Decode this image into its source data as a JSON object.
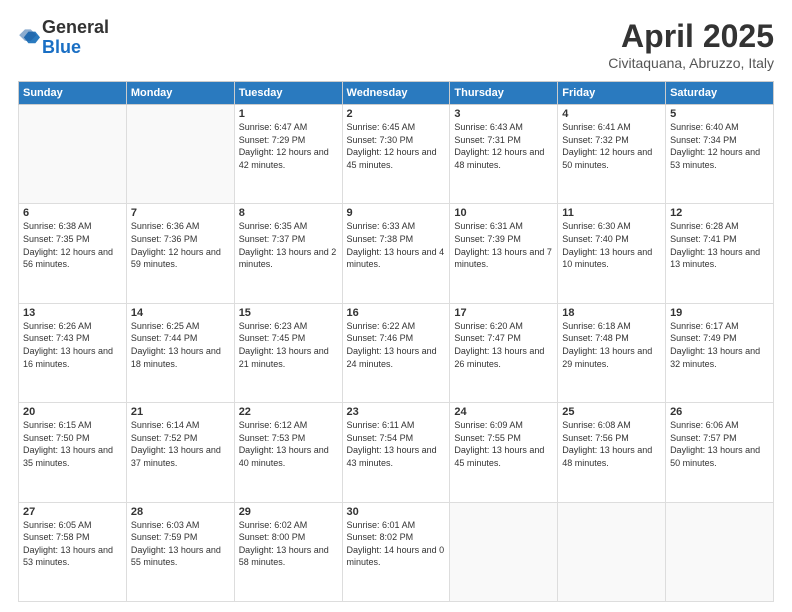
{
  "header": {
    "logo_general": "General",
    "logo_blue": "Blue",
    "title": "April 2025",
    "location": "Civitaquana, Abruzzo, Italy"
  },
  "weekdays": [
    "Sunday",
    "Monday",
    "Tuesday",
    "Wednesday",
    "Thursday",
    "Friday",
    "Saturday"
  ],
  "weeks": [
    [
      {
        "day": "",
        "sunrise": "",
        "sunset": "",
        "daylight": ""
      },
      {
        "day": "",
        "sunrise": "",
        "sunset": "",
        "daylight": ""
      },
      {
        "day": "1",
        "sunrise": "Sunrise: 6:47 AM",
        "sunset": "Sunset: 7:29 PM",
        "daylight": "Daylight: 12 hours and 42 minutes."
      },
      {
        "day": "2",
        "sunrise": "Sunrise: 6:45 AM",
        "sunset": "Sunset: 7:30 PM",
        "daylight": "Daylight: 12 hours and 45 minutes."
      },
      {
        "day": "3",
        "sunrise": "Sunrise: 6:43 AM",
        "sunset": "Sunset: 7:31 PM",
        "daylight": "Daylight: 12 hours and 48 minutes."
      },
      {
        "day": "4",
        "sunrise": "Sunrise: 6:41 AM",
        "sunset": "Sunset: 7:32 PM",
        "daylight": "Daylight: 12 hours and 50 minutes."
      },
      {
        "day": "5",
        "sunrise": "Sunrise: 6:40 AM",
        "sunset": "Sunset: 7:34 PM",
        "daylight": "Daylight: 12 hours and 53 minutes."
      }
    ],
    [
      {
        "day": "6",
        "sunrise": "Sunrise: 6:38 AM",
        "sunset": "Sunset: 7:35 PM",
        "daylight": "Daylight: 12 hours and 56 minutes."
      },
      {
        "day": "7",
        "sunrise": "Sunrise: 6:36 AM",
        "sunset": "Sunset: 7:36 PM",
        "daylight": "Daylight: 12 hours and 59 minutes."
      },
      {
        "day": "8",
        "sunrise": "Sunrise: 6:35 AM",
        "sunset": "Sunset: 7:37 PM",
        "daylight": "Daylight: 13 hours and 2 minutes."
      },
      {
        "day": "9",
        "sunrise": "Sunrise: 6:33 AM",
        "sunset": "Sunset: 7:38 PM",
        "daylight": "Daylight: 13 hours and 4 minutes."
      },
      {
        "day": "10",
        "sunrise": "Sunrise: 6:31 AM",
        "sunset": "Sunset: 7:39 PM",
        "daylight": "Daylight: 13 hours and 7 minutes."
      },
      {
        "day": "11",
        "sunrise": "Sunrise: 6:30 AM",
        "sunset": "Sunset: 7:40 PM",
        "daylight": "Daylight: 13 hours and 10 minutes."
      },
      {
        "day": "12",
        "sunrise": "Sunrise: 6:28 AM",
        "sunset": "Sunset: 7:41 PM",
        "daylight": "Daylight: 13 hours and 13 minutes."
      }
    ],
    [
      {
        "day": "13",
        "sunrise": "Sunrise: 6:26 AM",
        "sunset": "Sunset: 7:43 PM",
        "daylight": "Daylight: 13 hours and 16 minutes."
      },
      {
        "day": "14",
        "sunrise": "Sunrise: 6:25 AM",
        "sunset": "Sunset: 7:44 PM",
        "daylight": "Daylight: 13 hours and 18 minutes."
      },
      {
        "day": "15",
        "sunrise": "Sunrise: 6:23 AM",
        "sunset": "Sunset: 7:45 PM",
        "daylight": "Daylight: 13 hours and 21 minutes."
      },
      {
        "day": "16",
        "sunrise": "Sunrise: 6:22 AM",
        "sunset": "Sunset: 7:46 PM",
        "daylight": "Daylight: 13 hours and 24 minutes."
      },
      {
        "day": "17",
        "sunrise": "Sunrise: 6:20 AM",
        "sunset": "Sunset: 7:47 PM",
        "daylight": "Daylight: 13 hours and 26 minutes."
      },
      {
        "day": "18",
        "sunrise": "Sunrise: 6:18 AM",
        "sunset": "Sunset: 7:48 PM",
        "daylight": "Daylight: 13 hours and 29 minutes."
      },
      {
        "day": "19",
        "sunrise": "Sunrise: 6:17 AM",
        "sunset": "Sunset: 7:49 PM",
        "daylight": "Daylight: 13 hours and 32 minutes."
      }
    ],
    [
      {
        "day": "20",
        "sunrise": "Sunrise: 6:15 AM",
        "sunset": "Sunset: 7:50 PM",
        "daylight": "Daylight: 13 hours and 35 minutes."
      },
      {
        "day": "21",
        "sunrise": "Sunrise: 6:14 AM",
        "sunset": "Sunset: 7:52 PM",
        "daylight": "Daylight: 13 hours and 37 minutes."
      },
      {
        "day": "22",
        "sunrise": "Sunrise: 6:12 AM",
        "sunset": "Sunset: 7:53 PM",
        "daylight": "Daylight: 13 hours and 40 minutes."
      },
      {
        "day": "23",
        "sunrise": "Sunrise: 6:11 AM",
        "sunset": "Sunset: 7:54 PM",
        "daylight": "Daylight: 13 hours and 43 minutes."
      },
      {
        "day": "24",
        "sunrise": "Sunrise: 6:09 AM",
        "sunset": "Sunset: 7:55 PM",
        "daylight": "Daylight: 13 hours and 45 minutes."
      },
      {
        "day": "25",
        "sunrise": "Sunrise: 6:08 AM",
        "sunset": "Sunset: 7:56 PM",
        "daylight": "Daylight: 13 hours and 48 minutes."
      },
      {
        "day": "26",
        "sunrise": "Sunrise: 6:06 AM",
        "sunset": "Sunset: 7:57 PM",
        "daylight": "Daylight: 13 hours and 50 minutes."
      }
    ],
    [
      {
        "day": "27",
        "sunrise": "Sunrise: 6:05 AM",
        "sunset": "Sunset: 7:58 PM",
        "daylight": "Daylight: 13 hours and 53 minutes."
      },
      {
        "day": "28",
        "sunrise": "Sunrise: 6:03 AM",
        "sunset": "Sunset: 7:59 PM",
        "daylight": "Daylight: 13 hours and 55 minutes."
      },
      {
        "day": "29",
        "sunrise": "Sunrise: 6:02 AM",
        "sunset": "Sunset: 8:00 PM",
        "daylight": "Daylight: 13 hours and 58 minutes."
      },
      {
        "day": "30",
        "sunrise": "Sunrise: 6:01 AM",
        "sunset": "Sunset: 8:02 PM",
        "daylight": "Daylight: 14 hours and 0 minutes."
      },
      {
        "day": "",
        "sunrise": "",
        "sunset": "",
        "daylight": ""
      },
      {
        "day": "",
        "sunrise": "",
        "sunset": "",
        "daylight": ""
      },
      {
        "day": "",
        "sunrise": "",
        "sunset": "",
        "daylight": ""
      }
    ]
  ]
}
